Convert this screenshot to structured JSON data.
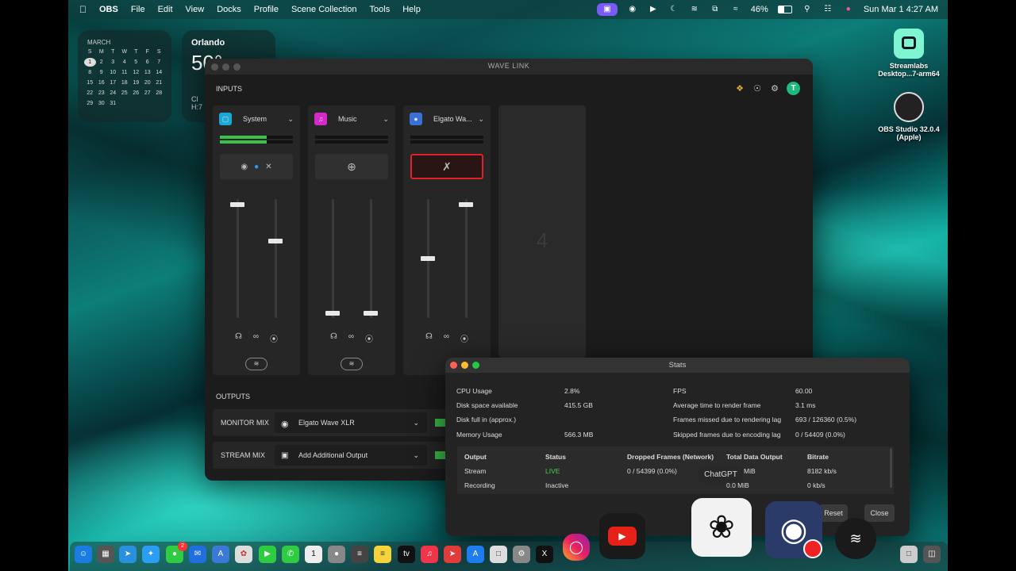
{
  "menubar": {
    "app": "OBS",
    "items": [
      "File",
      "Edit",
      "View",
      "Docks",
      "Profile",
      "Scene Collection",
      "Tools",
      "Help"
    ],
    "battery": "46%",
    "datetime": "Sun Mar 1  4:27 AM"
  },
  "calendar": {
    "month": "MARCH",
    "weekdays": [
      "S",
      "M",
      "T",
      "W",
      "T",
      "F",
      "S"
    ],
    "days": [
      "1",
      "2",
      "3",
      "4",
      "5",
      "6",
      "7",
      "8",
      "9",
      "10",
      "11",
      "12",
      "13",
      "14",
      "15",
      "16",
      "17",
      "18",
      "19",
      "20",
      "21",
      "22",
      "23",
      "24",
      "25",
      "26",
      "27",
      "28",
      "29",
      "30",
      "31"
    ]
  },
  "weather": {
    "city": "Orlando",
    "temp": "50°",
    "cond": "Cl",
    "hilo": "H:7"
  },
  "desktop_icons": [
    {
      "label": "Streamlabs Desktop...7-arm64"
    },
    {
      "label": "OBS Studio 32.0.4 (Apple)"
    }
  ],
  "wavelink": {
    "title": "WAVE LINK",
    "inputs_label": "INPUTS",
    "outputs_label": "OUTPUTS",
    "avatar_letter": "T",
    "channels": [
      {
        "name": "System",
        "icon_color": "#1aa8d8",
        "meter": 0.64,
        "fader_monitor": 0.97,
        "fader_stream": 0.65
      },
      {
        "name": "Music",
        "icon_color": "#d629c9",
        "meter": 0.0,
        "fader_monitor": 0.02,
        "fader_stream": 0.02
      },
      {
        "name": "Elgato Wa...",
        "icon_color": "#3b6fd8",
        "meter": 0.0,
        "fader_monitor": 0.5,
        "fader_stream": 0.97,
        "muted": true
      }
    ],
    "add_slot_number": "4",
    "outputs": [
      {
        "label": "MONITOR MIX",
        "device": "Elgato Wave XLR"
      },
      {
        "label": "STREAM MIX",
        "device": "Add Additional Output"
      }
    ]
  },
  "stats": {
    "title": "Stats",
    "left": [
      {
        "k": "CPU Usage",
        "v": "2.8%"
      },
      {
        "k": "Disk space available",
        "v": "415.5 GB"
      },
      {
        "k": "Disk full in (approx.)",
        "v": ""
      },
      {
        "k": "Memory Usage",
        "v": "566.3 MB"
      }
    ],
    "right": [
      {
        "k": "FPS",
        "v": "60.00"
      },
      {
        "k": "Average time to render frame",
        "v": "3.1 ms"
      },
      {
        "k": "Frames missed due to rendering lag",
        "v": "693 / 126360 (0.5%)"
      },
      {
        "k": "Skipped frames due to encoding lag",
        "v": "0 / 54409 (0.0%)"
      }
    ],
    "table_headers": [
      "Output",
      "Status",
      "Dropped Frames (Network)",
      "Total Data Output",
      "Bitrate"
    ],
    "rows": [
      {
        "output": "Stream",
        "status": "LIVE",
        "dropped": "0 / 54399 (0.0%)",
        "total": "MiB",
        "bitrate": "8182 kb/s"
      },
      {
        "output": "Recording",
        "status": "Inactive",
        "dropped": "",
        "total": "0.0 MiB",
        "bitrate": "0 kb/s"
      }
    ],
    "reset_label": "Reset",
    "close_label": "Close",
    "live_color": "#3fd24b"
  },
  "tooltip": "ChatGPT",
  "dock": {
    "badge_messages": "2"
  }
}
